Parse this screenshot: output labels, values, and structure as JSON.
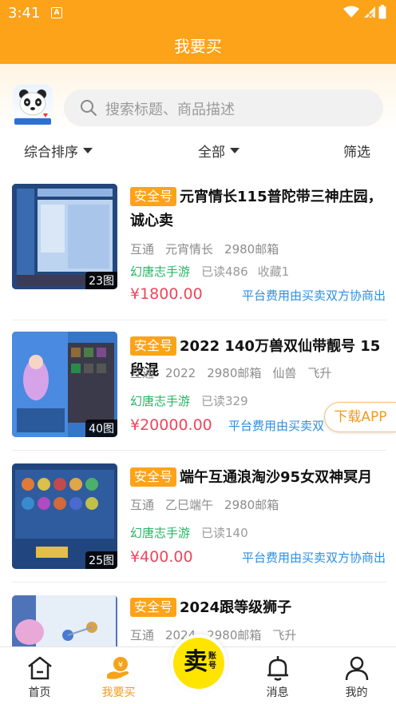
{
  "status_bar": {
    "time": "3:41"
  },
  "nav": {
    "title": "我要买"
  },
  "search": {
    "placeholder": "搜索标题、商品描述"
  },
  "filters": [
    {
      "label": "综合排序"
    },
    {
      "label": "全部"
    },
    {
      "label": "筛选"
    }
  ],
  "items": [
    {
      "badge": "安全号",
      "title": "元宵情长115普陀带三神庄园，诚心卖",
      "tags": [
        "互通",
        "元宵情长",
        "2980邮箱"
      ],
      "game": "幻唐志手游",
      "views": "已读486",
      "favorites": "收藏1",
      "price": "¥1800.00",
      "fee_note": "平台费用由买卖双方协商出",
      "image_count": "23图"
    },
    {
      "badge": "安全号",
      "title": "2022 140万兽双仙带靓号 15段混",
      "tags": [
        "互通",
        "2022",
        "2980邮箱",
        "仙兽",
        "飞升"
      ],
      "game": "幻唐志手游",
      "views": "已读329",
      "favorites": "",
      "price": "¥20000.00",
      "fee_note": "平台费用由买卖双",
      "image_count": "40图"
    },
    {
      "badge": "安全号",
      "title": "端午互通浪淘沙95女双神冥月",
      "tags": [
        "互通",
        "乙巳端午",
        "2980邮箱"
      ],
      "game": "幻唐志手游",
      "views": "已读140",
      "favorites": "",
      "price": "¥400.00",
      "fee_note": "平台费用由买卖双方协商出",
      "image_count": "25图"
    },
    {
      "badge": "安全号",
      "title": "2024跟等级狮子",
      "tags": [
        "互通",
        "2024",
        "2980邮箱",
        "飞升"
      ],
      "game": "",
      "views": "",
      "favorites": "",
      "price": "",
      "fee_note": "",
      "image_count": ""
    }
  ],
  "download_button": {
    "label": "下载APP"
  },
  "tab_bar": {
    "home": "首页",
    "buy": "我要买",
    "sell_main": "卖",
    "sell_sub": "账号",
    "messages": "消息",
    "mine": "我的"
  },
  "colors": {
    "brand_orange": "#fca31a",
    "price_red": "#f0455b",
    "link_blue": "#2d8fe0",
    "game_green": "#28b463",
    "sell_yellow": "#ffe400"
  }
}
